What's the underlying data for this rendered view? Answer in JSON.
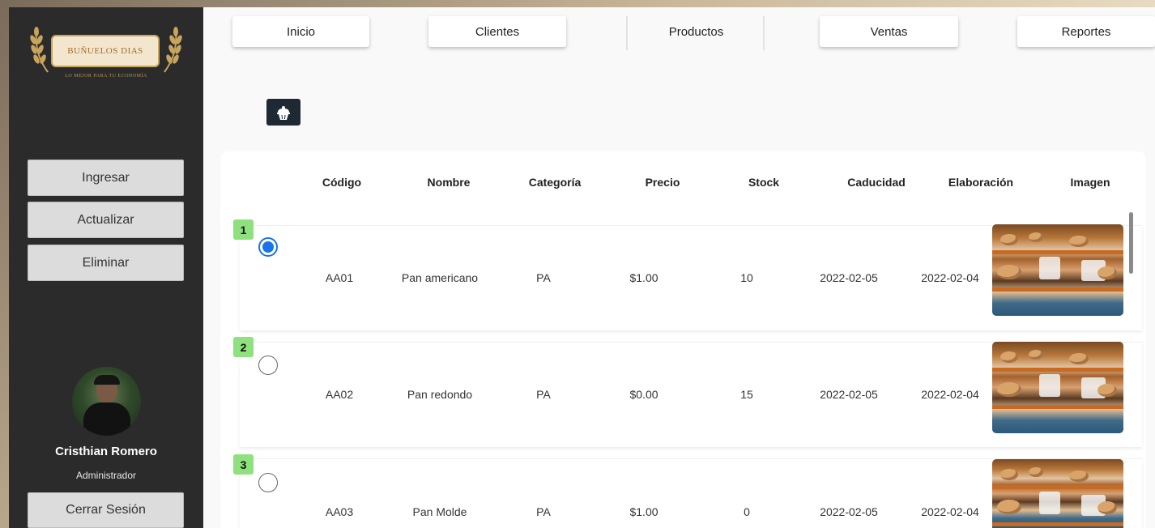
{
  "brand": {
    "name": "BUÑUELOS DIAS",
    "tagline": "LO MEJOR PARA TU ECONOMÍA"
  },
  "sidebar": {
    "actions": [
      "Ingresar",
      "Actualizar",
      "Eliminar"
    ],
    "user_name": "Cristhian Romero",
    "user_role": "Administrador",
    "logout": "Cerrar Sesión"
  },
  "nav": {
    "tabs": [
      "Inicio",
      "Clientes",
      "Productos",
      "Ventas",
      "Reportes"
    ]
  },
  "toolbar": {
    "add_icon": "cupcake-icon"
  },
  "table": {
    "headers": [
      "Código",
      "Nombre",
      "Categoría",
      "Precio",
      "Stock",
      "Caducidad",
      "Elaboración",
      "Imagen"
    ],
    "rows": [
      {
        "num": "1",
        "codigo": "AA01",
        "nombre": "Pan americano",
        "categoria": "PA",
        "precio": "$1.00",
        "stock": "10",
        "caducidad": "2022-02-05",
        "elaboracion": "2022-02-04",
        "selected": true
      },
      {
        "num": "2",
        "codigo": "AA02",
        "nombre": "Pan redondo",
        "categoria": "PA",
        "precio": "$0.00",
        "stock": "15",
        "caducidad": "2022-02-05",
        "elaboracion": "2022-02-04",
        "selected": false
      },
      {
        "num": "3",
        "codigo": "AA03",
        "nombre": "Pan Molde",
        "categoria": "PA",
        "precio": "$1.00",
        "stock": "0",
        "caducidad": "2022-02-05",
        "elaboracion": "2022-02-04",
        "selected": false
      }
    ]
  },
  "colors": {
    "sidebar": "#2b2b2b",
    "badge": "#8fe07e",
    "radio_selected": "#1a73e8",
    "add_button": "#1f2933"
  }
}
